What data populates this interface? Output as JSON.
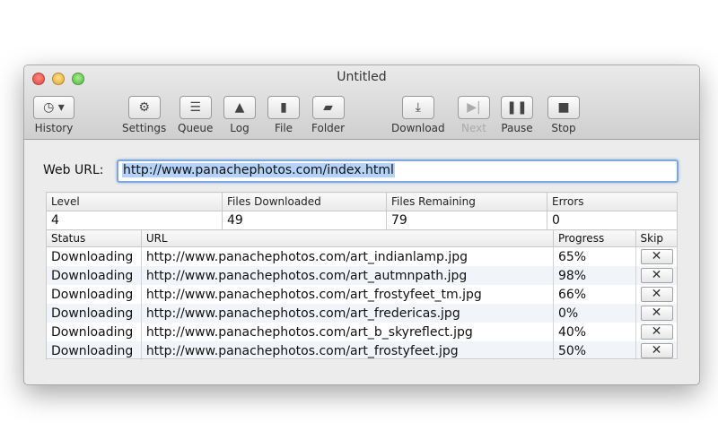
{
  "window": {
    "title": "Untitled"
  },
  "toolbar": {
    "history": "History",
    "settings": "Settings",
    "queue": "Queue",
    "log": "Log",
    "file": "File",
    "folder": "Folder",
    "download": "Download",
    "next": "Next",
    "pause": "Pause",
    "stop": "Stop"
  },
  "url": {
    "label": "Web URL:",
    "value": "http://www.panachephotos.com/index.html"
  },
  "stats": {
    "headers": [
      "Level",
      "Files Downloaded",
      "Files Remaining",
      "Errors"
    ],
    "values": [
      "4",
      "49",
      "79",
      "0"
    ]
  },
  "files": {
    "headers": [
      "Status",
      "URL",
      "Progress",
      "Skip"
    ],
    "skip_glyph": "✕",
    "rows": [
      {
        "status": "Downloading",
        "url": "http://www.panachephotos.com/art_indianlamp.jpg",
        "progress": "65%"
      },
      {
        "status": "Downloading",
        "url": "http://www.panachephotos.com/art_autmnpath.jpg",
        "progress": "98%"
      },
      {
        "status": "Downloading",
        "url": "http://www.panachephotos.com/art_frostyfeet_tm.jpg",
        "progress": "66%"
      },
      {
        "status": "Downloading",
        "url": "http://www.panachephotos.com/art_fredericas.jpg",
        "progress": "0%"
      },
      {
        "status": "Downloading",
        "url": "http://www.panachephotos.com/art_b_skyreflect.jpg",
        "progress": "40%"
      },
      {
        "status": "Downloading",
        "url": "http://www.panachephotos.com/art_frostyfeet.jpg",
        "progress": "50%"
      }
    ]
  }
}
